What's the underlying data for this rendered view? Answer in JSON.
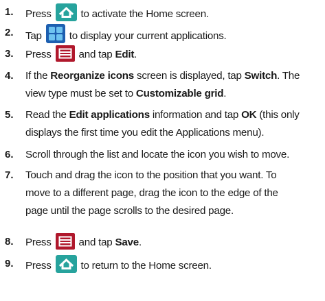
{
  "colors": {
    "home_icon_bg": "#27a39d",
    "apps_icon_bg": "#1d5fb0",
    "apps_icon_tile": "#6ec3f0",
    "menu_icon_bg": "#b0182c",
    "text": "#1a1a1a"
  },
  "icons": {
    "home": "home-key-icon",
    "apps": "applications-icon",
    "menu": "menu-key-icon"
  },
  "steps": [
    {
      "num": "1.",
      "pre": "Press",
      "post": "to activate the Home screen."
    },
    {
      "num": "2.",
      "pre": "Tap",
      "post": "to display your current applications."
    },
    {
      "num": "3.",
      "pre": "Press",
      "mid": "and tap",
      "bold": "Edit",
      "end": "."
    },
    {
      "num": "4.",
      "l1a": "If the ",
      "l1b": "Reorganize icons",
      "l1c": " screen is displayed, tap ",
      "l1d": "Switch",
      "l1e": ". The",
      "l2a": "view type must be set to ",
      "l2b": "Customizable grid",
      "l2c": "."
    },
    {
      "num": "5.",
      "l1a": "Read the ",
      "l1b": "Edit applications",
      "l1c": " information and tap ",
      "l1d": "OK",
      "l1e": " (this only",
      "l2a": "displays the first time you edit the Applications menu)."
    },
    {
      "num": "6.",
      "text": "Scroll through the list and locate the icon you wish to move."
    },
    {
      "num": "7.",
      "l1": "Touch and drag the icon to the position that you want. To",
      "l2": "move to a different page, drag the icon to the edge of the",
      "l3": "page until the page scrolls to the desired page."
    },
    {
      "num": "8.",
      "pre": "Press",
      "mid": "and tap",
      "bold": "Save",
      "end": "."
    },
    {
      "num": "9.",
      "pre": "Press",
      "post": "to return to the Home screen."
    }
  ]
}
